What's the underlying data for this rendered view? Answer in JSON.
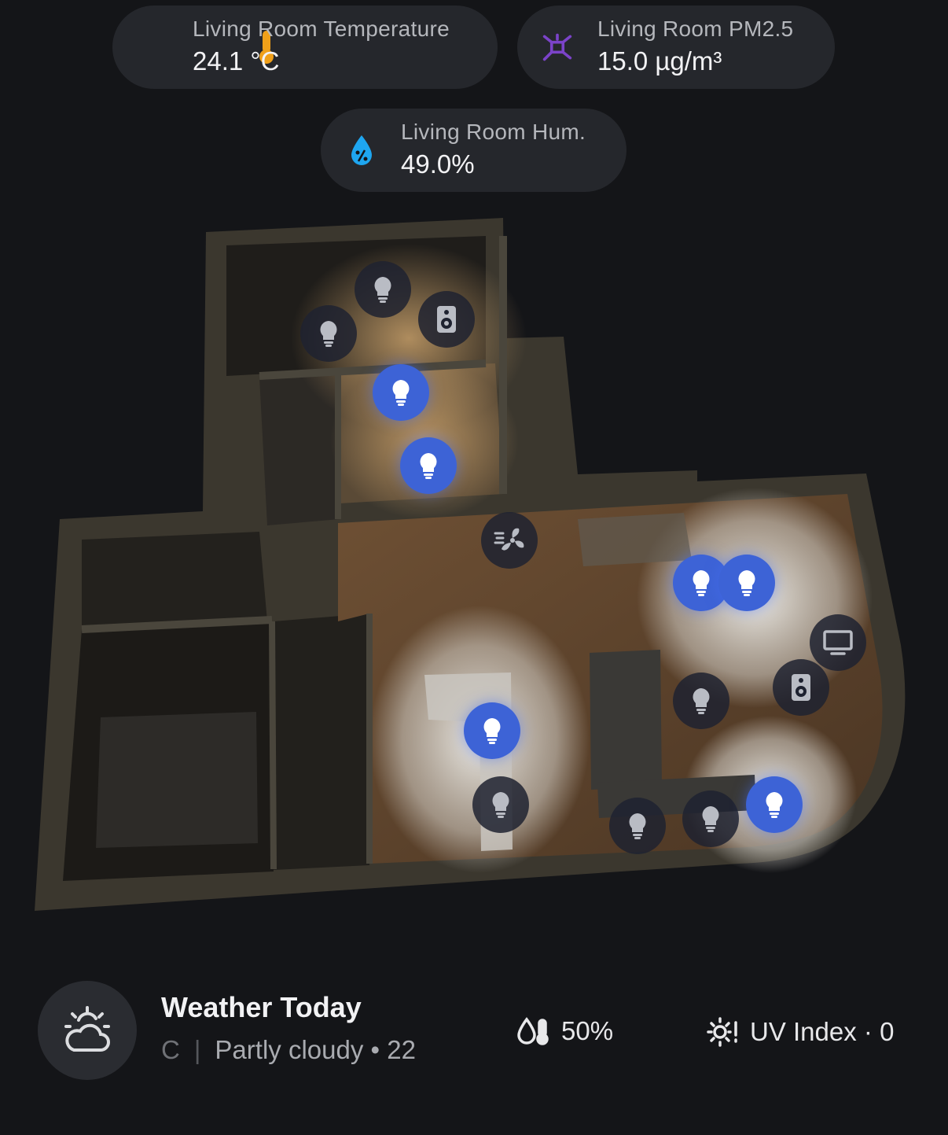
{
  "sensors": {
    "temperature": {
      "label": "Living Room Temperature",
      "value": "24.1 °C",
      "icon": "thermometer-icon",
      "color": "#f0a019"
    },
    "pm25": {
      "label": "Living Room PM2.5",
      "value": "15.0 µg/m³",
      "icon": "molecule-icon",
      "color": "#7b43c9"
    },
    "humidity": {
      "label": "Living Room Hum.",
      "value": "49.0%",
      "icon": "water-percent-icon",
      "color": "#1ea6f0"
    }
  },
  "devices": [
    {
      "type": "light",
      "state": "off",
      "room": "upper-room"
    },
    {
      "type": "light",
      "state": "off",
      "room": "upper-room"
    },
    {
      "type": "speaker",
      "state": "off",
      "room": "upper-room"
    },
    {
      "type": "light",
      "state": "on",
      "room": "bathroom"
    },
    {
      "type": "light",
      "state": "on",
      "room": "bathroom"
    },
    {
      "type": "fan",
      "state": "off",
      "room": "hallway"
    },
    {
      "type": "light",
      "state": "on",
      "room": "living-room"
    },
    {
      "type": "light",
      "state": "on",
      "room": "living-room"
    },
    {
      "type": "tv",
      "state": "off",
      "room": "living-room"
    },
    {
      "type": "speaker",
      "state": "off",
      "room": "living-room"
    },
    {
      "type": "light",
      "state": "off",
      "room": "living-room"
    },
    {
      "type": "light",
      "state": "on",
      "room": "dining"
    },
    {
      "type": "light",
      "state": "off",
      "room": "dining"
    },
    {
      "type": "light",
      "state": "off",
      "room": "living-room"
    },
    {
      "type": "light",
      "state": "off",
      "room": "living-room"
    },
    {
      "type": "light",
      "state": "on",
      "room": "living-room"
    }
  ],
  "weather": {
    "title": "Weather Today",
    "subtitle_prefix": "C",
    "subtitle_sep": "|",
    "subtitle": "Partly cloudy • 22",
    "humidity": "50%",
    "uv": "UV Index · 0",
    "icon": "partly-cloudy-icon"
  },
  "colors": {
    "accent_on": "#3d63d6",
    "device_off": "#1e2230",
    "card_bg": "#25272c",
    "page_bg": "#141518"
  }
}
